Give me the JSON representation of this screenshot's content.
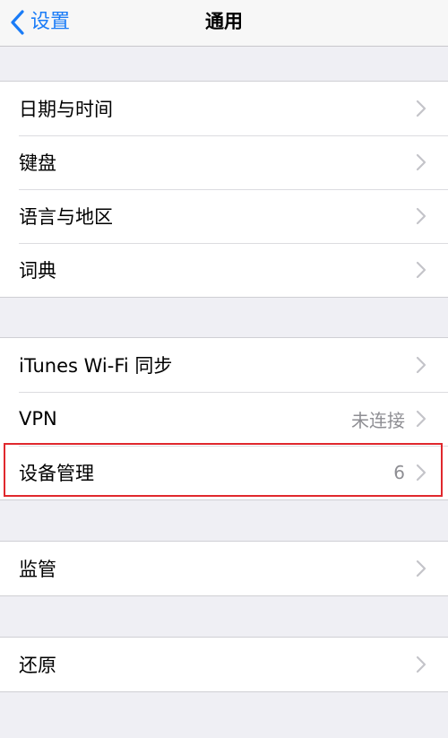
{
  "navbar": {
    "back_label": "设置",
    "title": "通用"
  },
  "groups": [
    {
      "items": [
        {
          "label": "日期与时间",
          "value": ""
        },
        {
          "label": "键盘",
          "value": ""
        },
        {
          "label": "语言与地区",
          "value": ""
        },
        {
          "label": "词典",
          "value": ""
        }
      ]
    },
    {
      "items": [
        {
          "label": "iTunes Wi-Fi 同步",
          "value": ""
        },
        {
          "label": "VPN",
          "value": "未连接"
        },
        {
          "label": "设备管理",
          "value": "6"
        }
      ]
    },
    {
      "items": [
        {
          "label": "监管",
          "value": ""
        }
      ]
    },
    {
      "items": [
        {
          "label": "还原",
          "value": ""
        }
      ]
    }
  ],
  "colors": {
    "accent": "#1a7cf7",
    "highlight_border": "#e0282d",
    "background": "#efeff4"
  }
}
